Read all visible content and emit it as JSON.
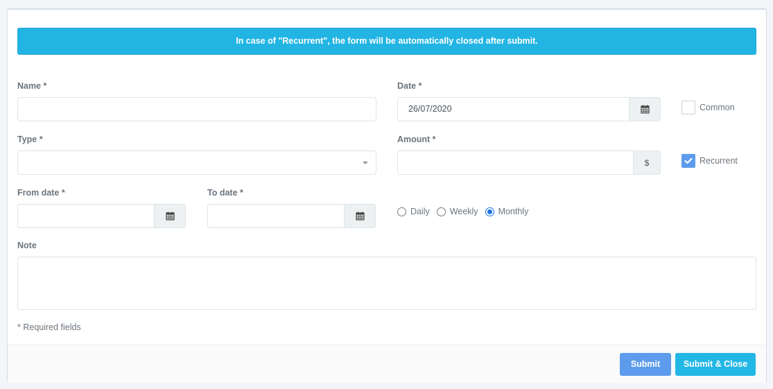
{
  "alert": {
    "message": "In case of \"Recurrent\", the form will be automatically closed after submit."
  },
  "form": {
    "name": {
      "label": "Name *",
      "value": ""
    },
    "date": {
      "label": "Date *",
      "value": "26/07/2020",
      "icon": "calendar-icon"
    },
    "common": {
      "label": "Common",
      "checked": false
    },
    "type": {
      "label": "Type *",
      "value": ""
    },
    "amount": {
      "label": "Amount *",
      "value": "",
      "addon": "$"
    },
    "recurrent": {
      "label": "Recurrent",
      "checked": true
    },
    "from_date": {
      "label": "From date *",
      "value": "",
      "icon": "calendar-icon"
    },
    "to_date": {
      "label": "To date *",
      "value": "",
      "icon": "calendar-icon"
    },
    "frequency": {
      "options": [
        {
          "label": "Daily",
          "checked": false
        },
        {
          "label": "Weekly",
          "checked": false
        },
        {
          "label": "Monthly",
          "checked": true
        }
      ]
    },
    "note": {
      "label": "Note",
      "value": ""
    },
    "required_note": "* Required fields"
  },
  "footer": {
    "submit_label": "Submit",
    "submit_close_label": "Submit & Close"
  },
  "colors": {
    "alert_bg": "#22b5e3",
    "submit_bg": "#5d9cec",
    "submit_close_bg": "#23b7e5",
    "checkbox_checked": "#5d9cec",
    "radio_checked": "#1a73e8"
  }
}
